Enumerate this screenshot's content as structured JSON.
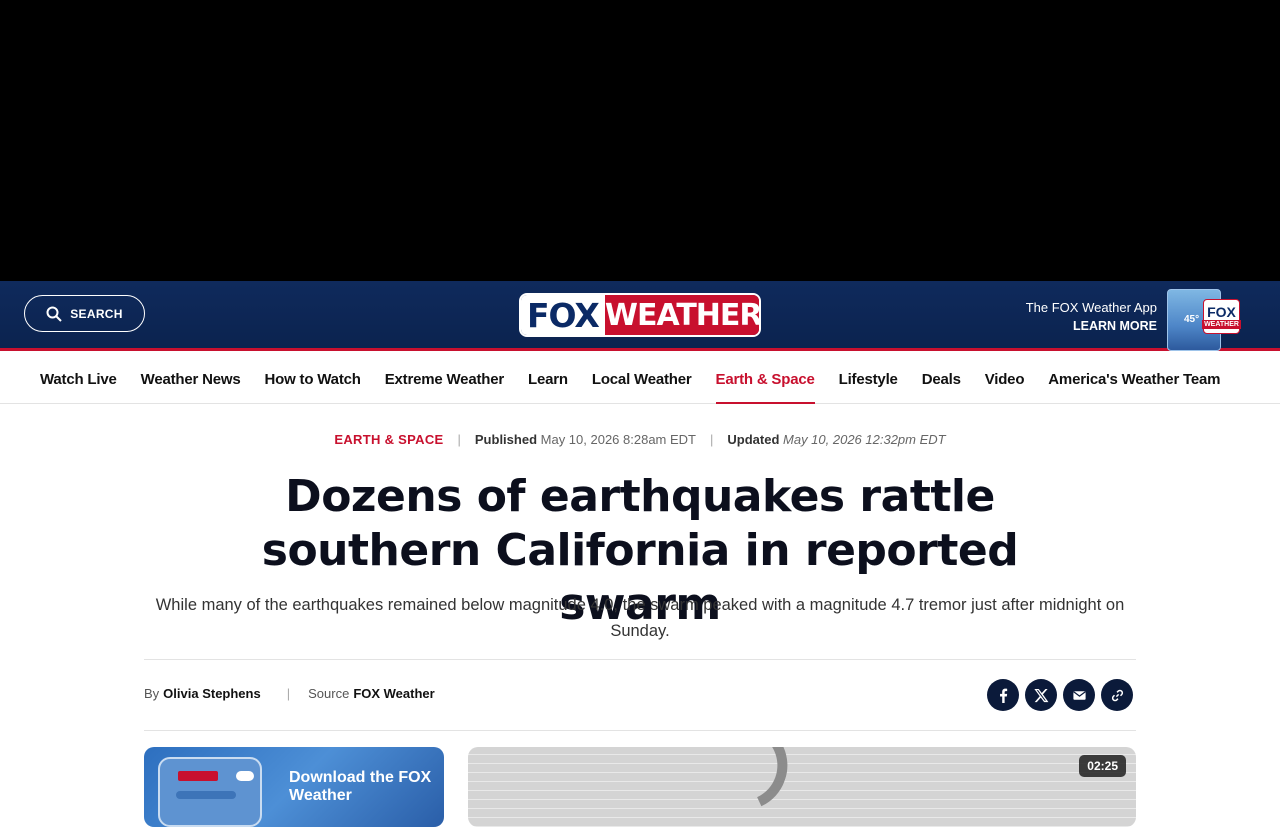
{
  "header": {
    "search_label": "SEARCH",
    "logo_fox": "FOX",
    "logo_weather": "WEATHER",
    "app_promo_title": "The FOX Weather App",
    "app_promo_cta": "LEARN MORE",
    "app_thumb_temp": "45°",
    "app_thumb_logo_fox": "FOX",
    "app_thumb_logo_weather": "WEATHER"
  },
  "nav": {
    "items": [
      {
        "label": "Watch Live"
      },
      {
        "label": "Weather News"
      },
      {
        "label": "How to Watch"
      },
      {
        "label": "Extreme Weather"
      },
      {
        "label": "Learn"
      },
      {
        "label": "Local Weather"
      },
      {
        "label": "Earth & Space",
        "active": true
      },
      {
        "label": "Lifestyle"
      },
      {
        "label": "Deals"
      },
      {
        "label": "Video"
      },
      {
        "label": "America's Weather Team"
      }
    ]
  },
  "article": {
    "category": "EARTH & SPACE",
    "published_label": "Published",
    "published_date": "May 10, 2026 8:28am EDT",
    "updated_label": "Updated",
    "updated_date": "May 10, 2026 12:32pm EDT",
    "headline": "Dozens of earthquakes rattle southern California in reported swarm",
    "dek": "While many of the earthquakes remained below magnitude 4.0, the swarm peaked with a magnitude 4.7 tremor just after midnight on Sunday.",
    "byline_prefix": "By",
    "author": "Olivia Stephens",
    "source_prefix": "Source",
    "source": "FOX Weather"
  },
  "promo": {
    "title": "Download the FOX Weather"
  },
  "video": {
    "duration": "02:25"
  },
  "colors": {
    "brand_navy": "#0f2a5c",
    "brand_red": "#c8102e"
  }
}
